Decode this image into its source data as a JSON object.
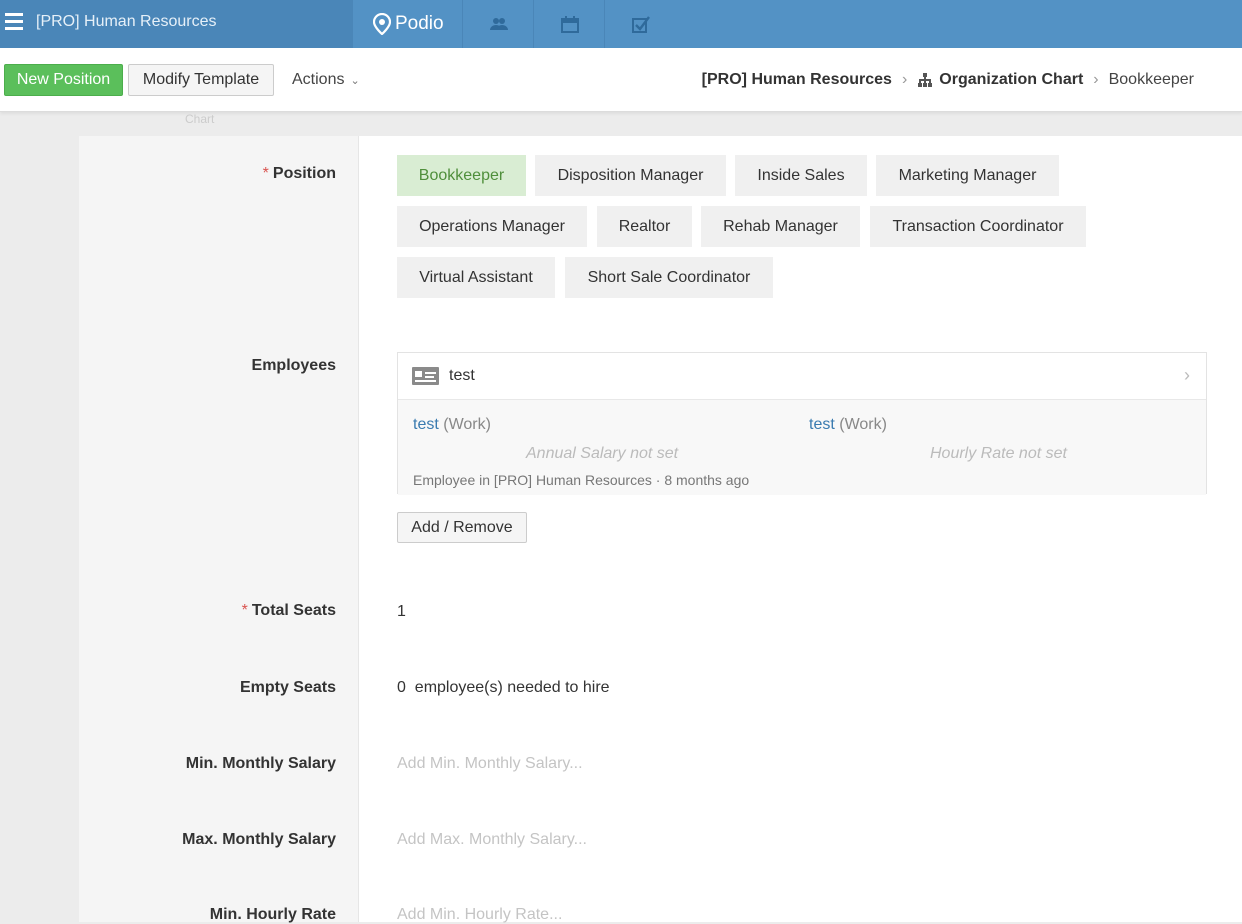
{
  "topbar": {
    "workspace_title": "[PRO] Human Resources",
    "logo_text": "Podio",
    "colors": {
      "bar": "#5392c5",
      "workspace": "#4a86b8"
    }
  },
  "actionbar": {
    "new_position": "New Position",
    "modify_template": "Modify Template",
    "actions": "Actions",
    "breadcrumb": {
      "workspace": "[PRO] Human Resources",
      "app": "Organization Chart",
      "item": "Bookkeeper"
    }
  },
  "ghost_header": "Chart",
  "fields": {
    "position": {
      "label": "Position",
      "options": [
        "Bookkeeper",
        "Disposition Manager",
        "Inside Sales",
        "Marketing Manager",
        "Operations Manager",
        "Realtor",
        "Rehab Manager",
        "Transaction Coordinator",
        "Virtual Assistant",
        "Short Sale Coordinator"
      ],
      "selected": "Bookkeeper"
    },
    "employees": {
      "label": "Employees",
      "card": {
        "name": "test",
        "left_link": "test",
        "left_type": "(Work)",
        "right_link": "test",
        "right_type": "(Work)",
        "salary": "Annual Salary not set",
        "hourly": "Hourly Rate not set",
        "meta": "Employee in [PRO] Human Resources · 8 months ago"
      },
      "add_remove": "Add / Remove"
    },
    "total_seats": {
      "label": "Total Seats",
      "value": "1"
    },
    "empty_seats": {
      "label": "Empty Seats",
      "value": "0",
      "suffix": "employee(s) needed to hire"
    },
    "min_monthly": {
      "label": "Min. Monthly Salary",
      "placeholder": "Add Min. Monthly Salary..."
    },
    "max_monthly": {
      "label": "Max. Monthly Salary",
      "placeholder": "Add Max. Monthly Salary..."
    },
    "min_hourly": {
      "label": "Min. Hourly Rate",
      "placeholder": "Add Min. Hourly Rate..."
    }
  }
}
